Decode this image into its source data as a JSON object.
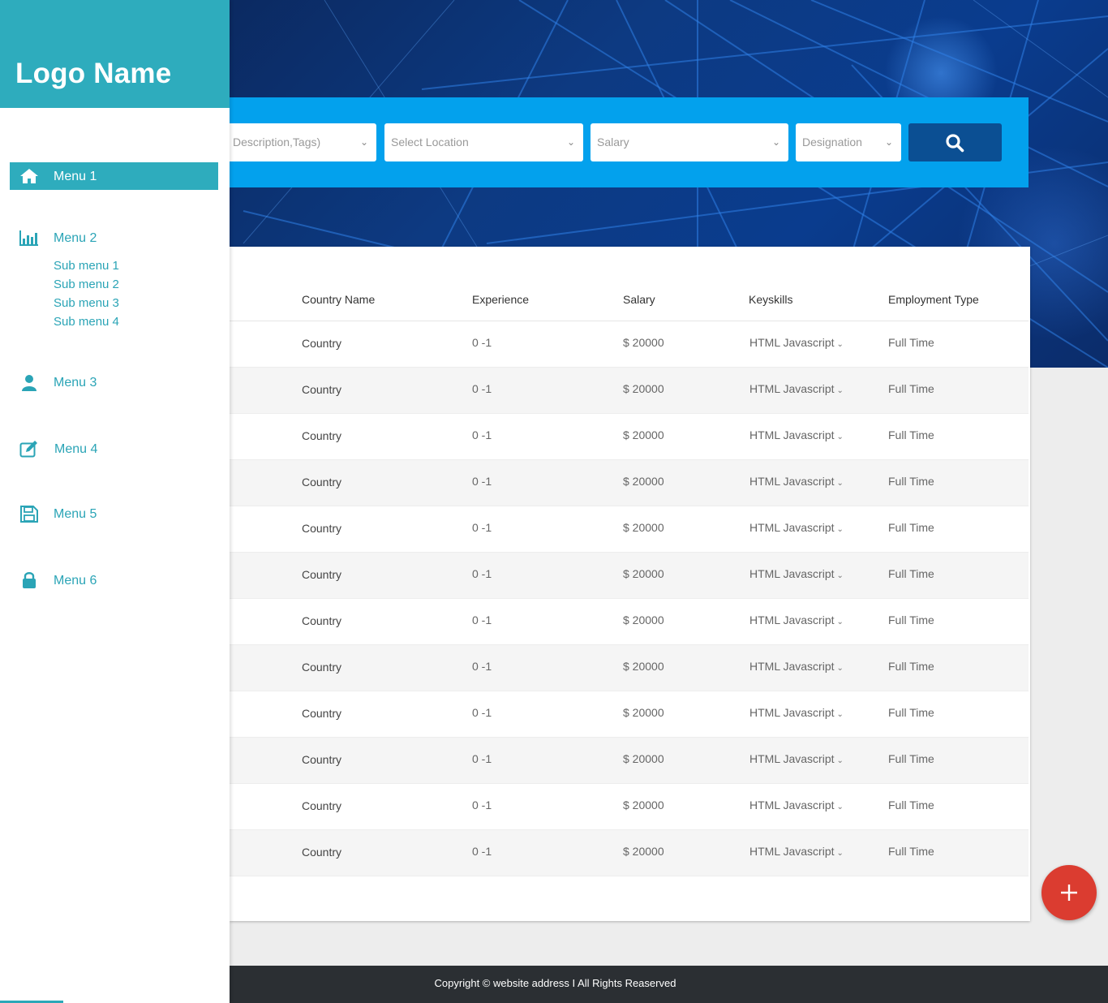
{
  "sidebar": {
    "logo": "Logo Name",
    "menus": [
      {
        "label": "Menu 1",
        "icon": "home-icon",
        "active": true
      },
      {
        "label": "Menu 2",
        "icon": "bar-chart-icon"
      },
      {
        "label": "Menu 3",
        "icon": "user-icon"
      },
      {
        "label": "Menu 4",
        "icon": "edit-icon"
      },
      {
        "label": "Menu 5",
        "icon": "save-icon"
      },
      {
        "label": "Menu 6",
        "icon": "lock-icon"
      }
    ],
    "submenus": [
      "Sub menu 1",
      "Sub menu 2",
      "Sub menu 3",
      "Sub menu 4"
    ]
  },
  "search": {
    "keyword_placeholder": "Description,Tags)",
    "location_placeholder": "Select Location",
    "salary_placeholder": "Salary",
    "designation_placeholder": "Designation",
    "button_icon": "search-icon"
  },
  "table": {
    "headers": [
      "Country Name",
      "Experience",
      "Salary",
      "Keyskills",
      "Employment Type"
    ],
    "rows": [
      [
        "Country",
        "0 -1",
        "$ 20000",
        "HTML Javascript",
        "Full Time"
      ],
      [
        "Country",
        "0 -1",
        "$ 20000",
        "HTML Javascript",
        "Full Time"
      ],
      [
        "Country",
        "0 -1",
        "$ 20000",
        "HTML Javascript",
        "Full Time"
      ],
      [
        "Country",
        "0 -1",
        "$ 20000",
        "HTML Javascript",
        "Full Time"
      ],
      [
        "Country",
        "0 -1",
        "$ 20000",
        "HTML Javascript",
        "Full Time"
      ],
      [
        "Country",
        "0 -1",
        "$ 20000",
        "HTML Javascript",
        "Full Time"
      ],
      [
        "Country",
        "0 -1",
        "$ 20000",
        "HTML Javascript",
        "Full Time"
      ],
      [
        "Country",
        "0 -1",
        "$ 20000",
        "HTML Javascript",
        "Full Time"
      ],
      [
        "Country",
        "0 -1",
        "$ 20000",
        "HTML Javascript",
        "Full Time"
      ],
      [
        "Country",
        "0 -1",
        "$ 20000",
        "HTML Javascript",
        "Full Time"
      ],
      [
        "Country",
        "0 -1",
        "$ 20000",
        "HTML Javascript",
        "Full Time"
      ],
      [
        "Country",
        "0 -1",
        "$ 20000",
        "HTML Javascript",
        "Full Time"
      ]
    ]
  },
  "footer": {
    "text": "Copyright © website address I All Rights Reaserved"
  },
  "fab": {
    "icon": "plus-icon"
  },
  "colors": {
    "accent": "#2eacbd",
    "search_bar": "#03a1ed",
    "search_button": "#0b4f93",
    "fab": "#db3c30",
    "footer": "#2b2f33"
  }
}
